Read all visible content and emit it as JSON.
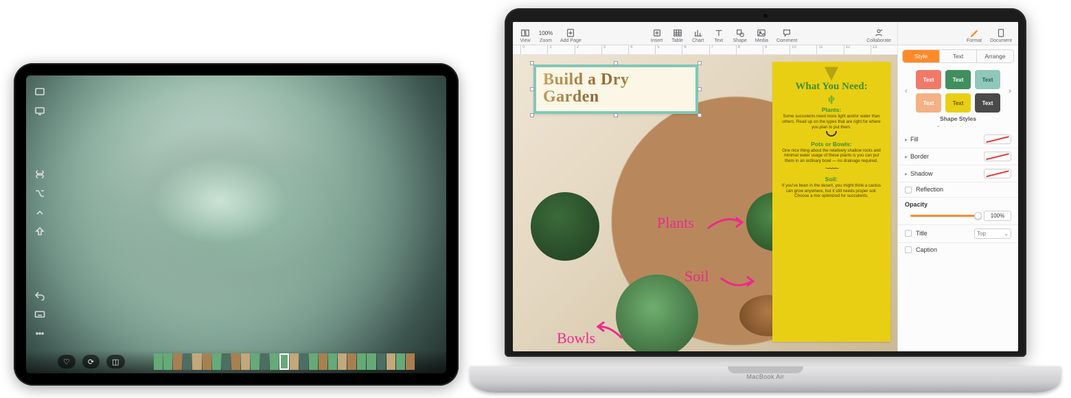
{
  "ipad": {
    "sidebar_icons": [
      "fullscreen",
      "display",
      "command",
      "pencil",
      "home",
      "pointer",
      "undo",
      "keyboard",
      "more"
    ],
    "bottombar": {
      "favorite": "♡",
      "edit": "⟳",
      "crop": "◫"
    }
  },
  "macbook": {
    "model_label": "MacBook Air"
  },
  "pages": {
    "toolbar_left": {
      "view": "View",
      "zoom_value": "100%",
      "zoom": "Zoom",
      "add_page": "Add Page"
    },
    "toolbar_center": {
      "insert": "Insert",
      "table": "Table",
      "chart": "Chart",
      "text": "Text",
      "shape": "Shape",
      "media": "Media",
      "comment": "Comment"
    },
    "toolbar_right": {
      "collaborate": "Collaborate",
      "format": "Format",
      "document": "Document"
    },
    "ruler_marks": [
      "0",
      "1",
      "2",
      "3",
      "4",
      "5",
      "6",
      "7",
      "8",
      "9",
      "10",
      "11",
      "12",
      "13"
    ],
    "canvas": {
      "title_text": "Build a Dry Garden",
      "hand_plants": "Plants",
      "hand_soil": "Soil",
      "hand_bowls": "Bowls",
      "info": {
        "heading": "What You Need:",
        "plants_h": "Plants:",
        "plants_p": "Some succulents need more light and/or water than others. Read up on the types that are right for where you plan to put them.",
        "pots_h": "Pots or Bowls:",
        "pots_p": "One nice thing about the relatively shallow roots and minimal water usage of these plants is you can put them in an ordinary bowl — no drainage required.",
        "soil_h": "Soil:",
        "soil_p": "If you've been in the desert, you might think a cactus can grow anywhere, but it still needs proper soil. Choose a mix optimized for succulents."
      }
    },
    "inspector": {
      "tabs": {
        "style": "Style",
        "text": "Text",
        "arrange": "Arrange"
      },
      "swatch_label": "Text",
      "swatch_colors": [
        "#f07a6a",
        "#3f8f5f",
        "#8fc8b8",
        "#f4b183",
        "#e9cf14",
        "#4a4a4a"
      ],
      "shape_styles": "Shape Styles",
      "fill": "Fill",
      "border": "Border",
      "shadow": "Shadow",
      "reflection": "Reflection",
      "opacity": "Opacity",
      "opacity_value": "100%",
      "title": "Title",
      "title_pos": "Top",
      "caption": "Caption"
    }
  }
}
